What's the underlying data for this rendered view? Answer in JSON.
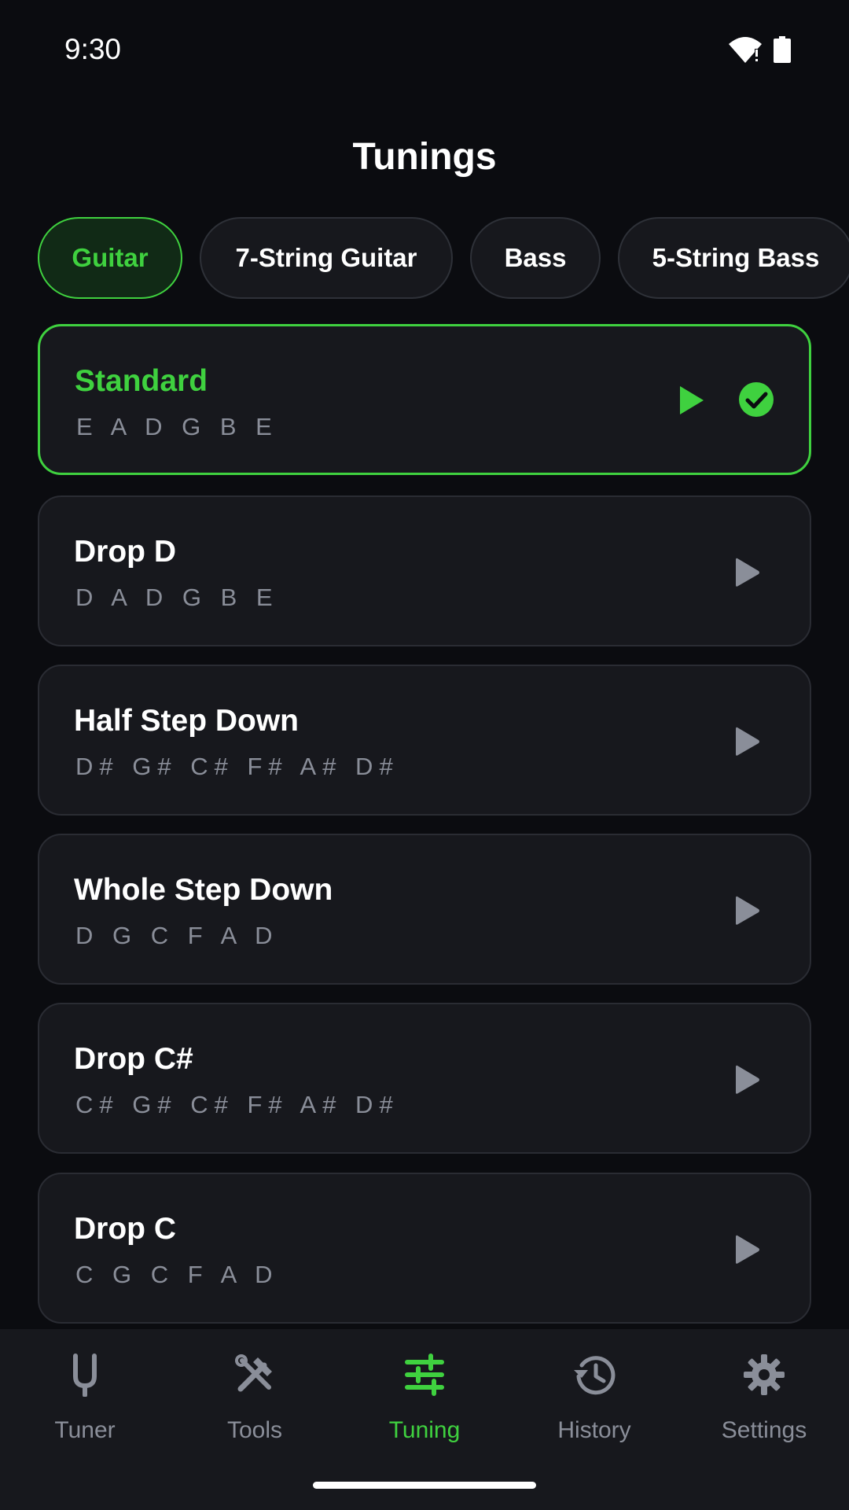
{
  "status_bar": {
    "time": "9:30"
  },
  "header": {
    "title": "Tunings"
  },
  "chips": [
    {
      "label": "Guitar",
      "active": true
    },
    {
      "label": "7-String Guitar",
      "active": false
    },
    {
      "label": "Bass",
      "active": false
    },
    {
      "label": "5-String Bass",
      "active": false
    }
  ],
  "tunings": [
    {
      "name": "Standard",
      "notes": "E A D G B E",
      "selected": true
    },
    {
      "name": "Drop D",
      "notes": "D A D G B E",
      "selected": false
    },
    {
      "name": "Half Step Down",
      "notes": "D# G# C# F# A# D#",
      "selected": false
    },
    {
      "name": "Whole Step Down",
      "notes": "D G C F A D",
      "selected": false
    },
    {
      "name": "Drop C#",
      "notes": "C# G# C# F# A# D#",
      "selected": false
    },
    {
      "name": "Drop C",
      "notes": "C G C F A D",
      "selected": false
    }
  ],
  "bottom_nav": [
    {
      "label": "Tuner",
      "icon": "tuning-fork-icon",
      "active": false
    },
    {
      "label": "Tools",
      "icon": "tools-icon",
      "active": false
    },
    {
      "label": "Tuning",
      "icon": "sliders-icon",
      "active": true
    },
    {
      "label": "History",
      "icon": "history-icon",
      "active": false
    },
    {
      "label": "Settings",
      "icon": "gear-icon",
      "active": false
    }
  ],
  "colors": {
    "accent": "#3fd13f",
    "background": "#0b0c10",
    "surface": "#17181d",
    "muted_text": "#8a8e99"
  }
}
